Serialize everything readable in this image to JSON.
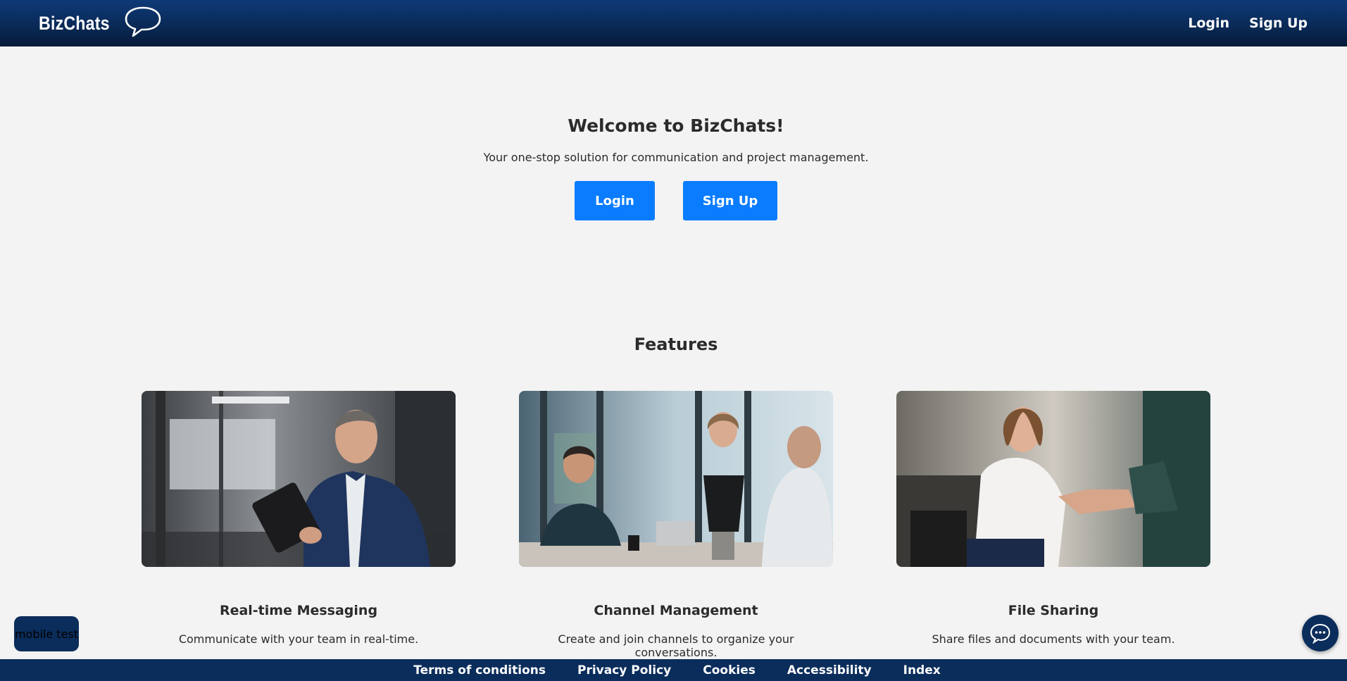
{
  "header": {
    "brand": "BizChats",
    "brand_icon": "speech-bubble-icon",
    "nav": {
      "login": "Login",
      "signup": "Sign Up"
    }
  },
  "hero": {
    "title": "Welcome to BizChats!",
    "subtitle": "Your one-stop solution for communication and project management.",
    "login_label": "Login",
    "signup_label": "Sign Up"
  },
  "features": {
    "title": "Features",
    "items": [
      {
        "title": "Real-time Messaging",
        "description": "Communicate with your team in real-time."
      },
      {
        "title": "Channel Management",
        "description": "Create and join channels to organize your conversations."
      },
      {
        "title": "File Sharing",
        "description": "Share files and documents with your team."
      }
    ]
  },
  "footer": {
    "links": [
      "Terms of conditions",
      "Privacy Policy",
      "Cookies",
      "Accessibility",
      "Index"
    ]
  },
  "floating": {
    "mobile_test_label": "mobile test",
    "chat_icon": "chat-bubble-icon"
  },
  "colors": {
    "header_bg": "#0a2a57",
    "accent": "#0a7cff",
    "footer_bg": "#0b2d5b",
    "page_bg": "#f3f3f3"
  }
}
